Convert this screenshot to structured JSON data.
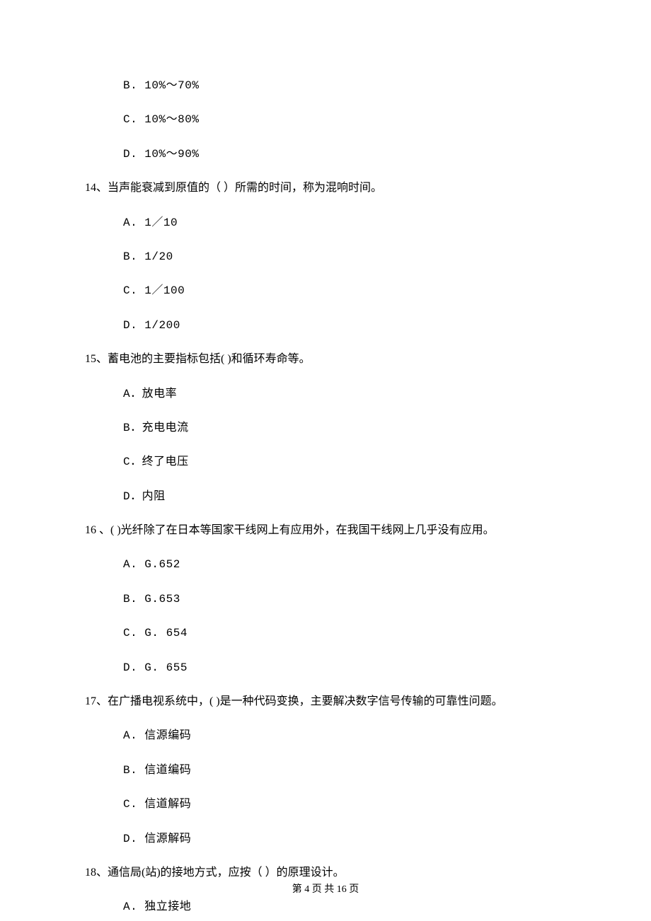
{
  "orphan_options": [
    "B. 10%～70%",
    "C. 10%～80%",
    "D. 10%～90%"
  ],
  "questions": [
    {
      "stem": "14、当声能衰减到原值的（    ）所需的时间，称为混响时间。",
      "options": [
        "A.  1／10",
        "B.  1/20",
        "C.  1／100",
        "D.  1/200"
      ]
    },
    {
      "stem": "15、蓄电池的主要指标包括(    )和循环寿命等。",
      "options": [
        "A．放电率",
        "B．充电电流",
        "C．终了电压",
        "D．内阻"
      ]
    },
    {
      "stem": "16 、(    )光纤除了在日本等国家干线网上有应用外，在我国干线网上几乎没有应用。",
      "options": [
        "A.  G.652",
        "B.  G.653",
        "C.  G. 654",
        "D.  G. 655"
      ]
    },
    {
      "stem": "17、在广播电视系统中，(    )是一种代码变换，主要解决数字信号传输的可靠性问题。",
      "options": [
        "A. 信源编码",
        "B. 信道编码",
        "C. 信道解码",
        "D. 信源解码"
      ]
    },
    {
      "stem": "18、通信局(站)的接地方式，应按（    ）的原理设计。",
      "options": [
        "A. 独立接地"
      ]
    }
  ],
  "footer": "第 4 页 共 16 页"
}
